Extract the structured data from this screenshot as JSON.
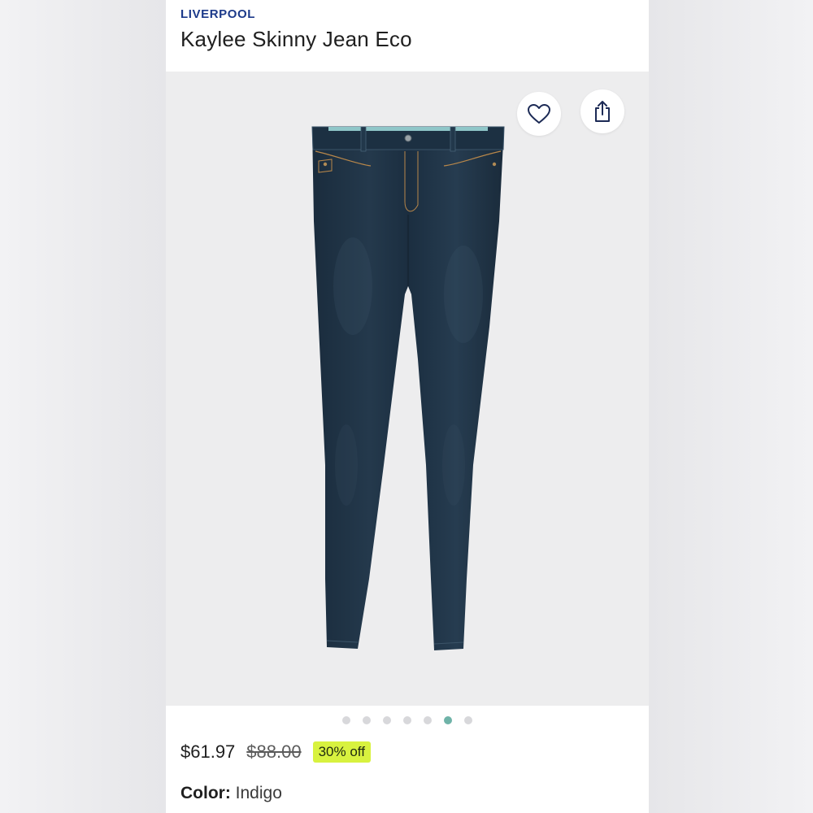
{
  "product": {
    "brand": "LIVERPOOL",
    "title": "Kaylee Skinny Jean Eco",
    "price": "$61.97",
    "original_price": "$88.00",
    "discount_badge": "30% off",
    "color_label": "Color:",
    "color_value": "Indigo"
  },
  "gallery": {
    "image_subject": "jeans",
    "total_images": 7,
    "active_index": 5,
    "favorite_icon": "heart-icon",
    "share_icon": "share-icon"
  },
  "colors": {
    "brand": "#1c3a8a",
    "discount_badge_bg": "#d8f23f",
    "active_dot": "#6fb3a8",
    "denim": "#1e3243"
  }
}
